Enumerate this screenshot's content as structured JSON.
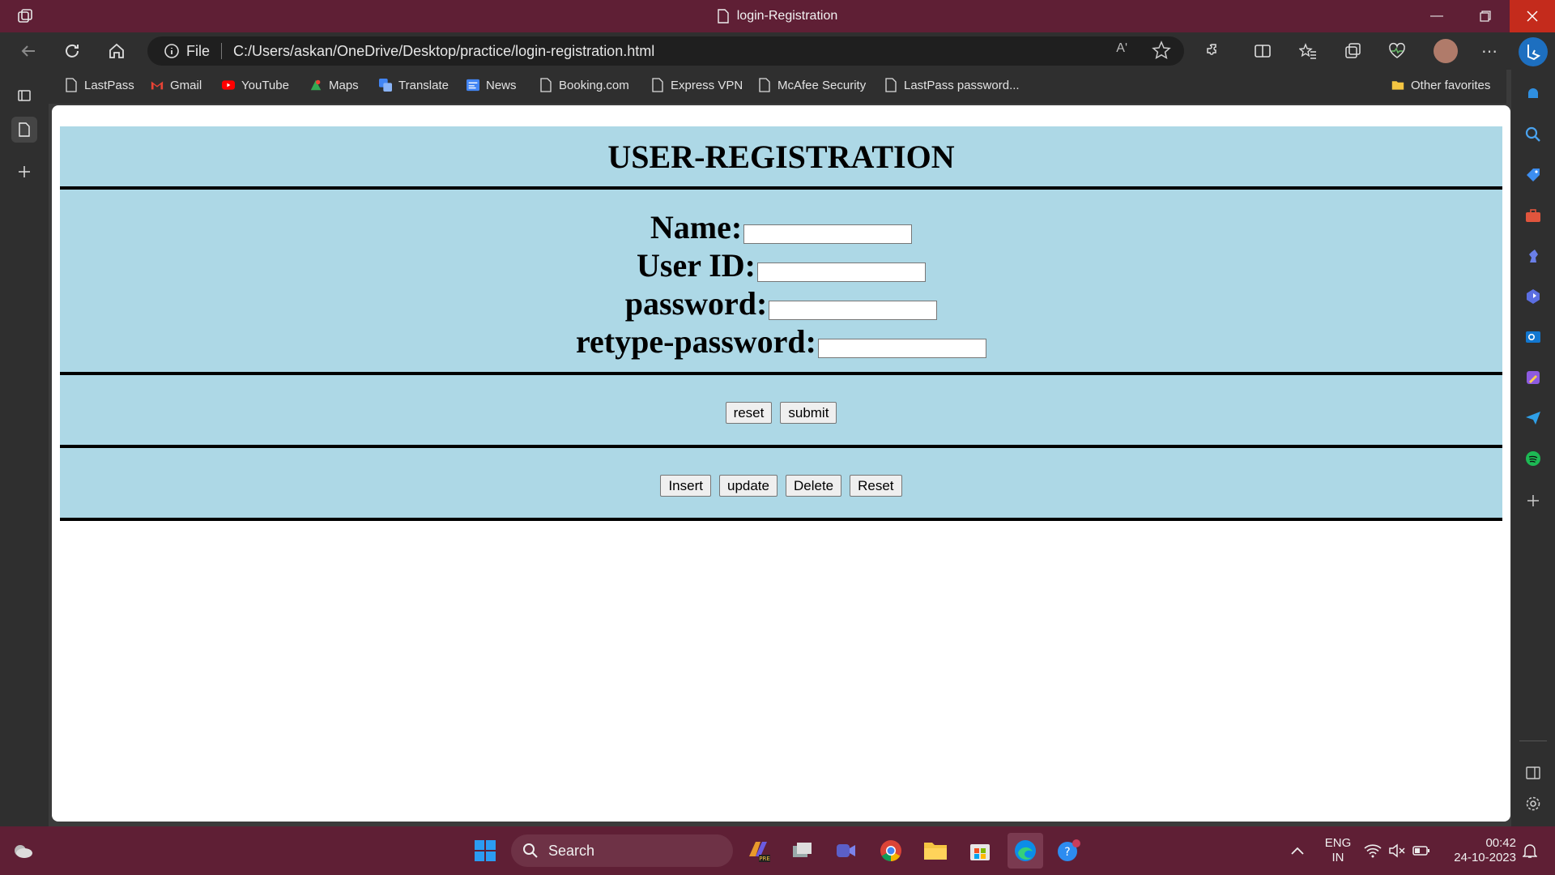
{
  "window": {
    "tab_title": "login-Registration"
  },
  "toolbar": {
    "address_scheme": "File",
    "url": "C:/Users/askan/OneDrive/Desktop/practice/login-registration.html",
    "read_aloud": "Aʹ"
  },
  "favorites": {
    "items": [
      "LastPass",
      "Gmail",
      "YouTube",
      "Maps",
      "Translate",
      "News",
      "Booking.com",
      "Express VPN",
      "McAfee Security",
      "LastPass password..."
    ],
    "other": "Other favorites"
  },
  "page": {
    "heading": "USER-REGISTRATION",
    "fields": {
      "name_label": "Name:",
      "userid_label": "User ID:",
      "password_label": "password:",
      "retype_label": "retype-password:"
    },
    "buttons_row1": {
      "reset": "reset",
      "submit": "submit"
    },
    "buttons_row2": {
      "insert": "Insert",
      "update": "update",
      "delete": "Delete",
      "reset": "Reset"
    },
    "colors": {
      "section_bg": "#add8e6",
      "divider": "#000000"
    }
  },
  "taskbar": {
    "search_label": "Search",
    "lang_top": "ENG",
    "lang_bottom": "IN",
    "time": "00:42",
    "date": "24-10-2023"
  },
  "theme": {
    "titlebar": "#5f1f35",
    "chrome": "#2f2f2f",
    "close": "#c42b1c"
  }
}
